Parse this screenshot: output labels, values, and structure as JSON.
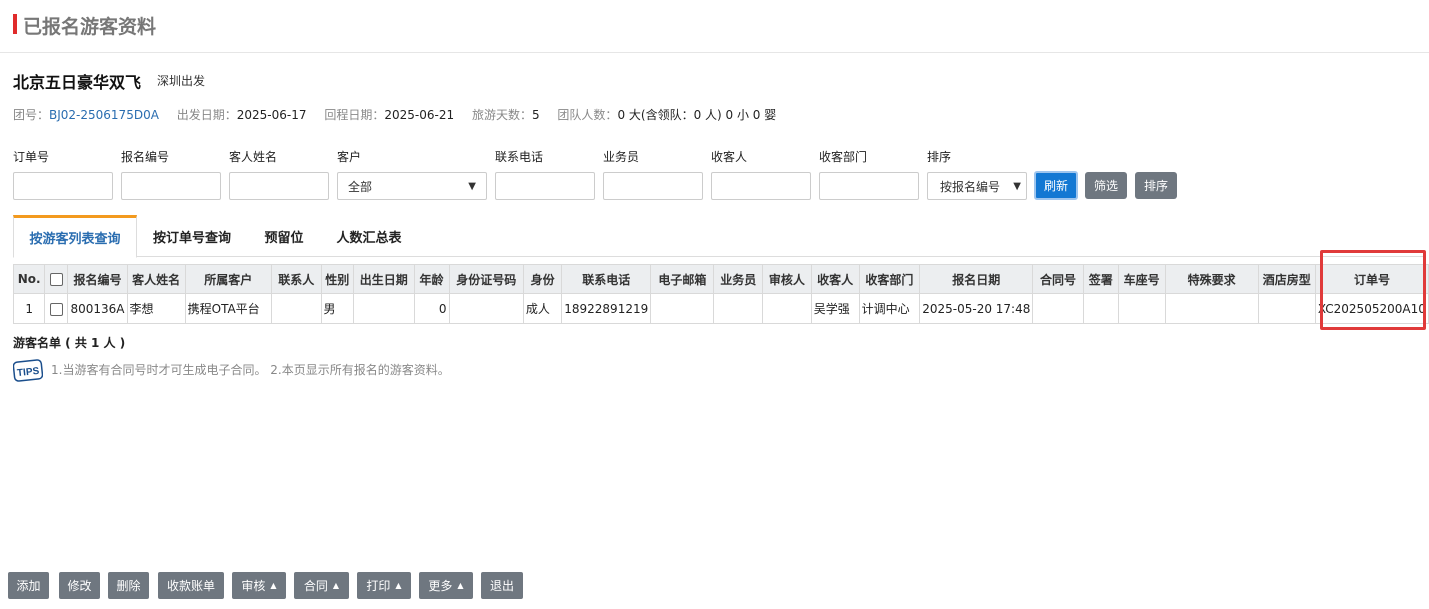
{
  "page": {
    "title": "已报名游客资料"
  },
  "tour": {
    "name": "北京五日豪华双飞",
    "depart": "深圳出发"
  },
  "info": [
    {
      "label": "团号：",
      "value": "BJ02-2506175D0A",
      "link": true
    },
    {
      "label": "出发日期：",
      "value": "2025-06-17",
      "link": false
    },
    {
      "label": "回程日期：",
      "value": "2025-06-21",
      "link": false
    },
    {
      "label": "旅游天数：",
      "value": "5",
      "link": false
    },
    {
      "label": "团队人数：",
      "value": "0 大(含领队：0 人) 0 小 0 婴",
      "link": false
    }
  ],
  "filters": {
    "labels": [
      "订单号",
      "报名编号",
      "客人姓名",
      "客户",
      "联系电话",
      "业务员",
      "收客人",
      "收客部门",
      "排序"
    ],
    "customer_selected": "全部",
    "sort_selected": "按报名编号",
    "refresh": "刷新",
    "filter": "筛选",
    "sort": "排序"
  },
  "tabs": [
    "按游客列表查询",
    "按订单号查询",
    "预留位",
    "人数汇总表"
  ],
  "table": {
    "headers": [
      "No.",
      "",
      "报名编号",
      "客人姓名",
      "所属客户",
      "联系人",
      "性别",
      "出生日期",
      "年龄",
      "身份证号码",
      "身份",
      "联系电话",
      "电子邮箱",
      "业务员",
      "审核人",
      "收客人",
      "收客部门",
      "报名日期",
      "合同号",
      "签署",
      "车座号",
      "特殊要求",
      "酒店房型",
      "订单号"
    ],
    "rows": [
      [
        "1",
        "",
        "800136A",
        "李想",
        "携程OTA平台",
        "",
        "男",
        "",
        "0",
        "",
        "成人",
        "18922891219",
        "",
        "",
        "",
        "吴学强",
        "计调中心",
        "2025-05-20 17:48",
        "",
        "",
        "",
        "",
        "",
        "XC202505200A10"
      ]
    ]
  },
  "summary": "游客名单 ( 共 1 人 )",
  "tips": {
    "icon_text": "TIPS",
    "text": "1.当游客有合同号时才可生成电子合同。  2.本页显示所有报名的游客资料。"
  },
  "bottom_buttons": [
    {
      "label": "添加",
      "dropdown": false
    },
    {
      "label": "修改",
      "dropdown": false
    },
    {
      "label": "删除",
      "dropdown": false
    },
    {
      "label": "收款账单",
      "dropdown": false
    },
    {
      "label": "审核",
      "dropdown": true
    },
    {
      "label": "合同",
      "dropdown": true
    },
    {
      "label": "打印",
      "dropdown": true
    },
    {
      "label": "更多",
      "dropdown": true
    },
    {
      "label": "退出",
      "dropdown": false
    }
  ],
  "colors": {
    "accent_blue": "#1378d3",
    "title_bar": "#e02b2b",
    "tab_active_top": "#f39a1e",
    "highlight": "#e03a3a",
    "button_gray": "#6f7780"
  }
}
